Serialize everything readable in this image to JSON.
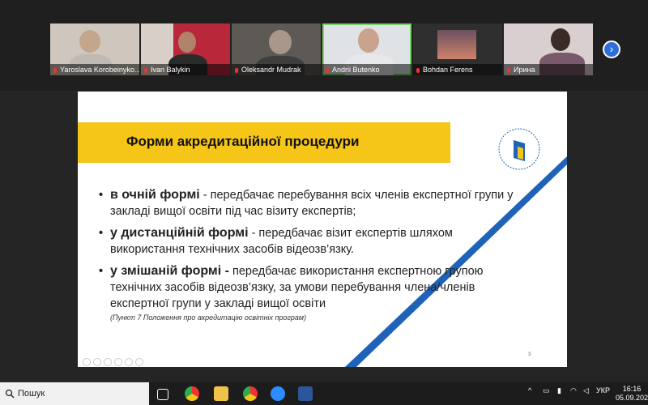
{
  "participants": [
    {
      "name": "Yaroslava Korobeinyko..."
    },
    {
      "name": "Ivan Balykin"
    },
    {
      "name": "Oleksandr Mudrak"
    },
    {
      "name": "Andrii Butenko"
    },
    {
      "name": "Bohdan Ferens"
    },
    {
      "name": "Ирина"
    }
  ],
  "slide": {
    "title": "Форми акредитаційної процедури",
    "bullets": [
      {
        "keyword": "в очній формі",
        "text": " - передбачає перебування всіх членів експертної групи у закладі вищої освіти під час візиту експертів;"
      },
      {
        "keyword": "у дистанційній формі",
        "text": " - передбачає візит експертів шляхом використання технічних засобів відеозв’язку."
      },
      {
        "keyword": "у змішаній формі -",
        "text": " передбачає використання експертною групою технічних засобів відеозв’язку, за умови перебування члена/членів експертної групи у закладі вищої освіти"
      }
    ],
    "note": "(Пункт 7 Положення про акредитацію освітніх програм)",
    "page_number": "3"
  },
  "taskbar": {
    "search_label": "Пошук",
    "language": "УКР",
    "time": "16:16",
    "date": "05.09.202"
  },
  "colors": {
    "title_band": "#f5c518",
    "accent_blue": "#1e63b8"
  }
}
